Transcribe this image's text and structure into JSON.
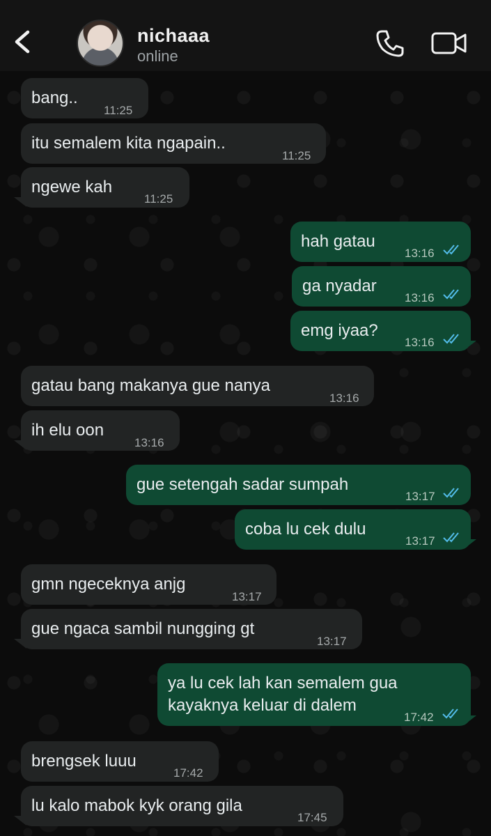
{
  "header": {
    "contact_name": "nichaaa",
    "status": "online"
  },
  "icons": {
    "back": "chevron-left-icon",
    "call": "phone-icon",
    "video": "video-camera-icon",
    "read_receipt": "double-check-icon"
  },
  "colors": {
    "incoming_bubble": "#222424",
    "outgoing_bubble": "#0f4a33",
    "read_tick": "#53bdeb"
  },
  "messages": [
    {
      "dir": "in",
      "text": "bang..",
      "time": "11:25"
    },
    {
      "dir": "in",
      "text": "itu semalem kita ngapain..",
      "time": "11:25"
    },
    {
      "dir": "in",
      "text": "ngewe kah",
      "time": "11:25"
    },
    {
      "dir": "out",
      "text": "hah gatau",
      "time": "13:16"
    },
    {
      "dir": "out",
      "text": "ga nyadar",
      "time": "13:16"
    },
    {
      "dir": "out",
      "text": "emg iyaa?",
      "time": "13:16"
    },
    {
      "dir": "in",
      "text": "gatau bang makanya gue nanya",
      "time": "13:16"
    },
    {
      "dir": "in",
      "text": "ih elu oon",
      "time": "13:16"
    },
    {
      "dir": "out",
      "text": "gue setengah sadar sumpah",
      "time": "13:17"
    },
    {
      "dir": "out",
      "text": "coba lu cek dulu",
      "time": "13:17"
    },
    {
      "dir": "in",
      "text": "gmn ngeceknya anjg",
      "time": "13:17"
    },
    {
      "dir": "in",
      "text": "gue ngaca sambil nungging gt",
      "time": "13:17"
    },
    {
      "dir": "out",
      "text": "ya lu cek lah kan semalem gua",
      "text2": "kayaknya keluar di dalem",
      "time": "17:42"
    },
    {
      "dir": "in",
      "text": "brengsek luuu",
      "time": "17:42"
    },
    {
      "dir": "in",
      "text": "lu kalo mabok kyk orang gila",
      "time": "17:45"
    }
  ]
}
